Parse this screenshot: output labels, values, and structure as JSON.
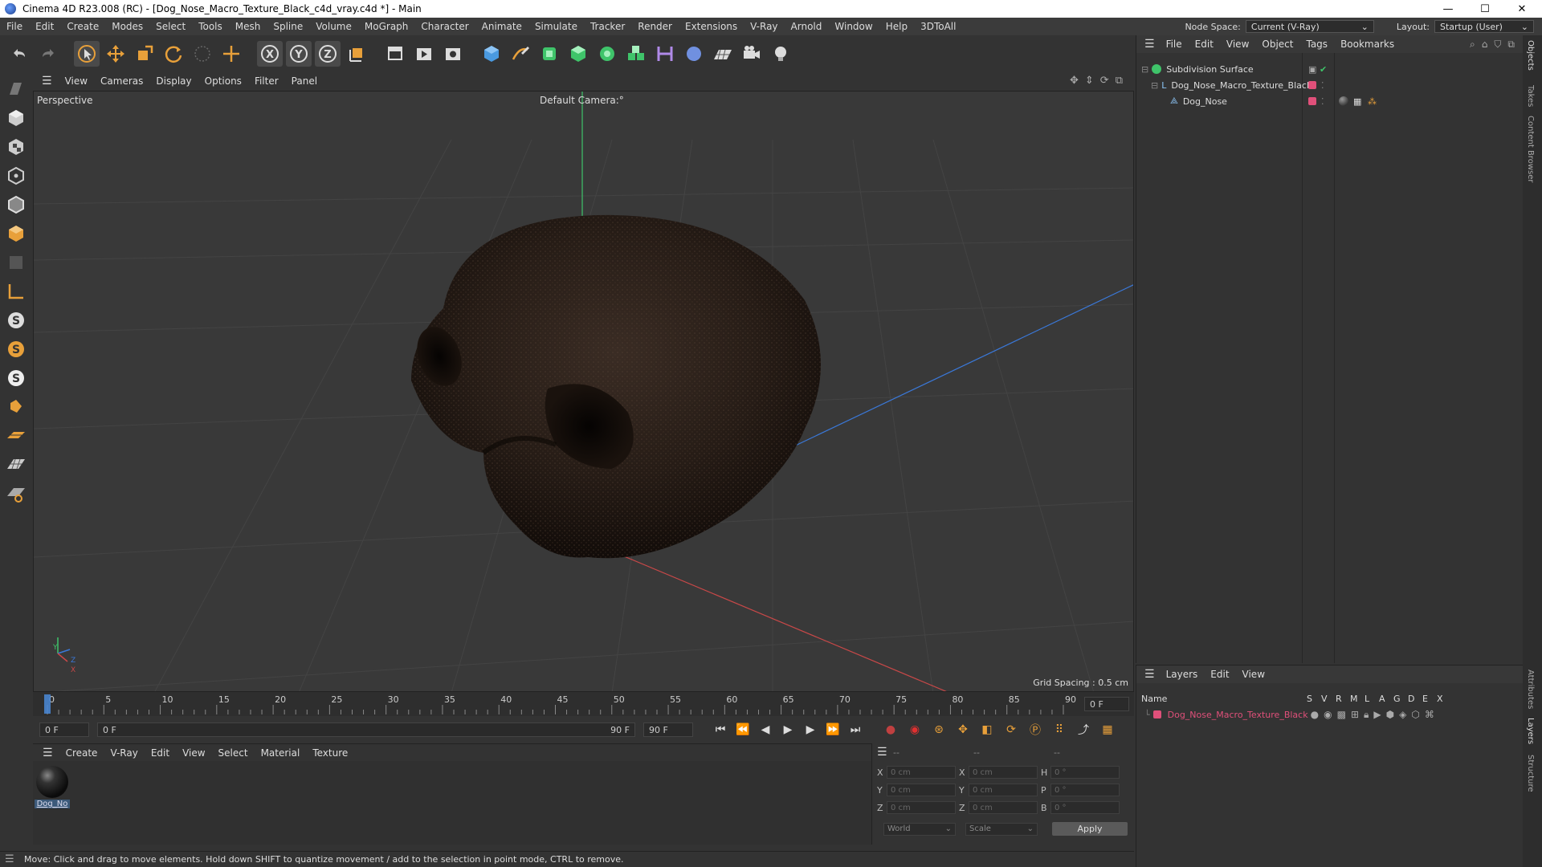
{
  "window": {
    "title": "Cinema 4D R23.008 (RC) - [Dog_Nose_Macro_Texture_Black_c4d_vray.c4d *] - Main",
    "controls": {
      "minimize": "—",
      "maximize": "☐",
      "close": "✕"
    }
  },
  "menubar": {
    "items": [
      "File",
      "Edit",
      "Create",
      "Modes",
      "Select",
      "Tools",
      "Mesh",
      "Spline",
      "Volume",
      "MoGraph",
      "Character",
      "Animate",
      "Simulate",
      "Tracker",
      "Render",
      "Extensions",
      "V-Ray",
      "Arnold",
      "Window",
      "Help",
      "3DToAll"
    ],
    "node_space_label": "Node Space:",
    "node_space_value": "Current (V-Ray)",
    "layout_label": "Layout:",
    "layout_value": "Startup (User)"
  },
  "viewport": {
    "menu": [
      "View",
      "Cameras",
      "Display",
      "Options",
      "Filter",
      "Panel"
    ],
    "projection": "Perspective",
    "camera": "Default Camera",
    "camera_suffix": ":°",
    "grid_spacing": "Grid Spacing : 0.5 cm",
    "axis_labels": {
      "y": "Y",
      "z": "Z",
      "x": "X"
    }
  },
  "timeline": {
    "ticks": [
      "0",
      "5",
      "10",
      "15",
      "20",
      "25",
      "30",
      "35",
      "40",
      "45",
      "50",
      "55",
      "60",
      "65",
      "70",
      "75",
      "80",
      "85",
      "90"
    ],
    "current_frame_display": "0 F",
    "start_field": "0 F",
    "range_start": "0 F",
    "range_end": "90 F",
    "end_field": "90 F"
  },
  "material_manager": {
    "menu": [
      "Create",
      "V-Ray",
      "Edit",
      "View",
      "Select",
      "Material",
      "Texture"
    ],
    "materials": [
      {
        "label": "Dog_No"
      }
    ]
  },
  "coordinates": {
    "header": [
      "--",
      "--",
      "--"
    ],
    "rows": [
      {
        "a": "X",
        "av": "0 cm",
        "b": "X",
        "bv": "0 cm",
        "c": "H",
        "cv": "0 °"
      },
      {
        "a": "Y",
        "av": "0 cm",
        "b": "Y",
        "bv": "0 cm",
        "c": "P",
        "cv": "0 °"
      },
      {
        "a": "Z",
        "av": "0 cm",
        "b": "Z",
        "bv": "0 cm",
        "c": "B",
        "cv": "0 °"
      }
    ],
    "mode": "World",
    "scale": "Scale",
    "apply": "Apply"
  },
  "status": {
    "text": "Move: Click and drag to move elements. Hold down SHIFT to quantize movement / add to the selection in point mode, CTRL to remove."
  },
  "object_manager": {
    "menu": [
      "File",
      "Edit",
      "View",
      "Object",
      "Tags",
      "Bookmarks"
    ],
    "objects": [
      {
        "name": "Subdivision Surface"
      },
      {
        "name": "Dog_Nose_Macro_Texture_Black"
      },
      {
        "name": "Dog_Nose"
      }
    ]
  },
  "layer_manager": {
    "menu": [
      "Layers",
      "Edit",
      "View"
    ],
    "columns": [
      "Name",
      "S",
      "V",
      "R",
      "M",
      "L",
      "A",
      "G",
      "D",
      "E",
      "X"
    ],
    "layers": [
      {
        "name": "Dog_Nose_Macro_Texture_Black",
        "color": "#e0507a"
      }
    ]
  },
  "side_tabs": [
    "Objects",
    "Takes",
    "Content Browser",
    "Attributes",
    "Layers",
    "Structure"
  ],
  "colors": {
    "accent": "#e0507a",
    "green_axis": "#3fc46a",
    "blue_axis": "#3a78d8",
    "red_axis": "#c84848"
  }
}
